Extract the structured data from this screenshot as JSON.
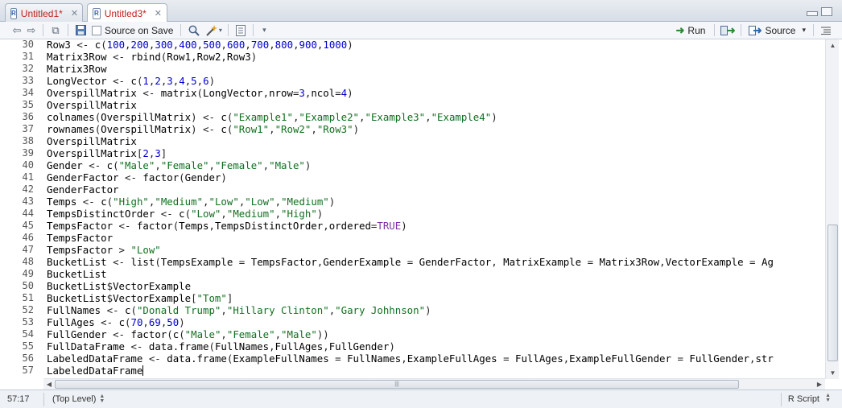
{
  "tabs": [
    {
      "label": "Untitled1*",
      "active": false
    },
    {
      "label": "Untitled3*",
      "active": true
    }
  ],
  "toolbar": {
    "source_on_save_label": "Source on Save",
    "run_label": "Run",
    "source_label": "Source"
  },
  "editor": {
    "lines": [
      {
        "num": "30",
        "text": "Row3 <- c(100,200,300,400,500,600,700,800,900,1000)"
      },
      {
        "num": "31",
        "text": "Matrix3Row <- rbind(Row1,Row2,Row3)"
      },
      {
        "num": "32",
        "text": "Matrix3Row"
      },
      {
        "num": "33",
        "text": "LongVector <- c(1,2,3,4,5,6)"
      },
      {
        "num": "34",
        "text": "OverspillMatrix <- matrix(LongVector,nrow=3,ncol=4)"
      },
      {
        "num": "35",
        "text": "OverspillMatrix"
      },
      {
        "num": "36",
        "text": "colnames(OverspillMatrix) <- c(\"Example1\",\"Example2\",\"Example3\",\"Example4\")"
      },
      {
        "num": "37",
        "text": "rownames(OverspillMatrix) <- c(\"Row1\",\"Row2\",\"Row3\")"
      },
      {
        "num": "38",
        "text": "OverspillMatrix"
      },
      {
        "num": "39",
        "text": "OverspillMatrix[2,3]"
      },
      {
        "num": "40",
        "text": "Gender <- c(\"Male\",\"Female\",\"Female\",\"Male\")"
      },
      {
        "num": "41",
        "text": "GenderFactor <- factor(Gender)"
      },
      {
        "num": "42",
        "text": "GenderFactor"
      },
      {
        "num": "43",
        "text": "Temps <- c(\"High\",\"Medium\",\"Low\",\"Low\",\"Medium\")"
      },
      {
        "num": "44",
        "text": "TempsDistinctOrder <- c(\"Low\",\"Medium\",\"High\")"
      },
      {
        "num": "45",
        "text": "TempsFactor <- factor(Temps,TempsDistinctOrder,ordered=TRUE)"
      },
      {
        "num": "46",
        "text": "TempsFactor"
      },
      {
        "num": "47",
        "text": "TempsFactor > \"Low\""
      },
      {
        "num": "48",
        "text": "BucketList <- list(TempsExample = TempsFactor,GenderExample = GenderFactor, MatrixExample = Matrix3Row,VectorExample = Ag"
      },
      {
        "num": "49",
        "text": "BucketList"
      },
      {
        "num": "50",
        "text": "BucketList$VectorExample"
      },
      {
        "num": "51",
        "text": "BucketList$VectorExample[\"Tom\"]"
      },
      {
        "num": "52",
        "text": "FullNames <- c(\"Donald Trump\",\"Hillary Clinton\",\"Gary Johhnson\")"
      },
      {
        "num": "53",
        "text": "FullAges <- c(70,69,50)"
      },
      {
        "num": "54",
        "text": "FullGender <- factor(c(\"Male\",\"Female\",\"Male\"))"
      },
      {
        "num": "55",
        "text": "FullDataFrame <- data.frame(FullNames,FullAges,FullGender)"
      },
      {
        "num": "56",
        "text": "LabeledDataFrame <- data.frame(ExampleFullNames = FullNames,ExampleFullAges = FullAges,ExampleFullGender = FullGender,str"
      },
      {
        "num": "57",
        "text": "LabeledDataFrame"
      }
    ]
  },
  "statusbar": {
    "position": "57:17",
    "scope": "(Top Level)",
    "language": "R Script"
  },
  "colors": {
    "string": "#107020",
    "number": "#0000d0",
    "keyword": "#7d2fa8",
    "tab_label": "#c0241f"
  },
  "icons": [
    "back-icon",
    "forward-icon",
    "show-in-window-icon",
    "save-icon",
    "find-icon",
    "code-tools-wand-icon",
    "compile-notebook-icon",
    "run-icon",
    "rerun-icon",
    "source-icon",
    "outline-icon"
  ]
}
